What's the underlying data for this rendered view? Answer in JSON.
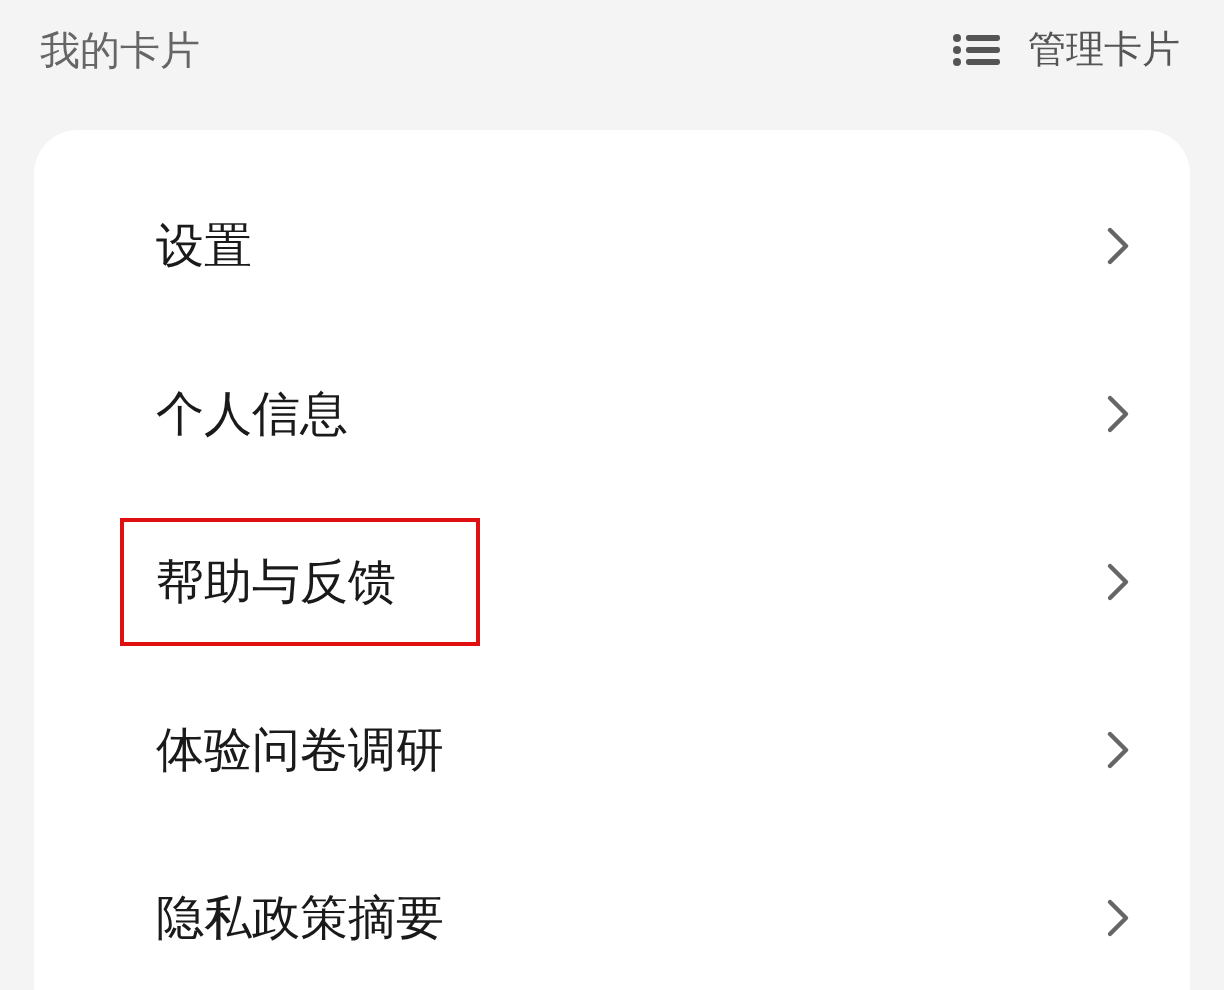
{
  "header": {
    "title": "我的卡片",
    "action": "管理卡片"
  },
  "menu": [
    {
      "label": "设置",
      "highlighted": false
    },
    {
      "label": "个人信息",
      "highlighted": false
    },
    {
      "label": "帮助与反馈",
      "highlighted": true
    },
    {
      "label": "体验问卷调研",
      "highlighted": false
    },
    {
      "label": "隐私政策摘要",
      "highlighted": false
    }
  ]
}
